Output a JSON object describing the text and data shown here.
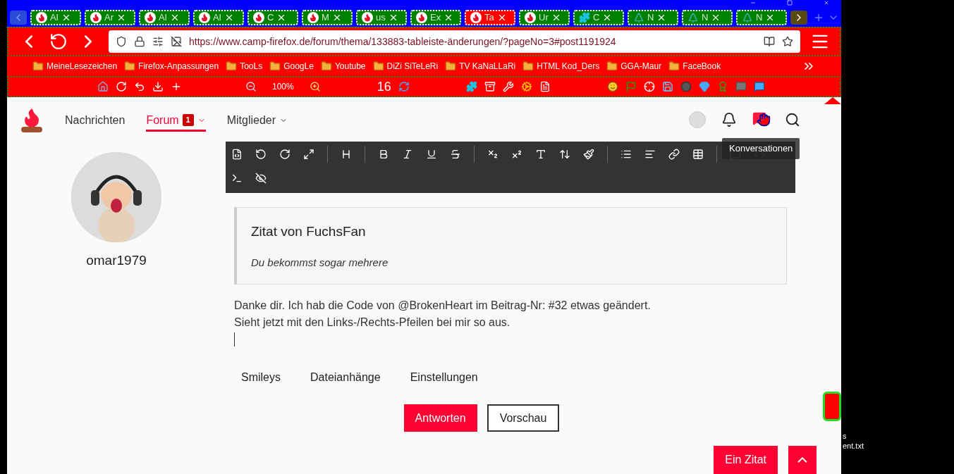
{
  "tabs": [
    {
      "label": "Al",
      "kind": "flame",
      "selected": false
    },
    {
      "label": "Ar",
      "kind": "flame",
      "selected": false
    },
    {
      "label": "Al",
      "kind": "flame",
      "selected": false
    },
    {
      "label": "Al",
      "kind": "flame",
      "selected": false
    },
    {
      "label": "C",
      "kind": "flame",
      "selected": false
    },
    {
      "label": "M",
      "kind": "flame",
      "selected": false
    },
    {
      "label": "us",
      "kind": "flame",
      "selected": false
    },
    {
      "label": "Ex",
      "kind": "flame",
      "selected": false
    },
    {
      "label": "Ta",
      "kind": "flame",
      "selected": true
    },
    {
      "label": "Ur",
      "kind": "flame",
      "selected": false
    },
    {
      "label": "C",
      "kind": "puzzle",
      "selected": false
    },
    {
      "label": "N",
      "kind": "tree",
      "selected": false
    },
    {
      "label": "N",
      "kind": "tree",
      "selected": false
    },
    {
      "label": "N",
      "kind": "tree",
      "selected": false
    }
  ],
  "address_bar": {
    "url": "https://www.camp-firefox.de/forum/thema/133883-tableiste-änderungen/?pageNo=3#post1191924"
  },
  "bookmarks": [
    "MeineLesezeichen",
    "Firefox-Anpassungen",
    "TooLs",
    "GoogLe",
    "Youtube",
    "DiZi SiTeLeRi",
    "TV KaNaLLaRi",
    "HTML Kod_Ders",
    "GGA-Maur",
    "FaceBook"
  ],
  "toolbar": {
    "zoom": "100%",
    "count": "16"
  },
  "site_nav": [
    {
      "label": "Nachrichten",
      "selected": false,
      "has_menu": false
    },
    {
      "label": "Forum",
      "selected": true,
      "has_menu": true,
      "badge": "1"
    },
    {
      "label": "Mitglieder",
      "selected": false,
      "has_menu": true
    }
  ],
  "tooltip": "Konversationen",
  "author": "omar1979",
  "quote": {
    "title": "Zitat von FuchsFan",
    "text": "Du bekommst sogar mehrere"
  },
  "message_lines": [
    "Danke dir. Ich hab die Code von @BrokenHeart im Beitrag-Nr: #32 etwas geändert.",
    "Sieht jetzt mit den Links-/Rechts-Pfeilen bei mir so aus."
  ],
  "editor_tabs": [
    "Smileys",
    "Dateianhänge",
    "Einstellungen"
  ],
  "buttons": [
    {
      "label": "Antworten",
      "kind": "primary"
    },
    {
      "label": "Vorschau",
      "kind": "secondary"
    }
  ],
  "post_button": "Ein Zitat",
  "desktop_labels": [
    "s",
    "ent.txt"
  ]
}
